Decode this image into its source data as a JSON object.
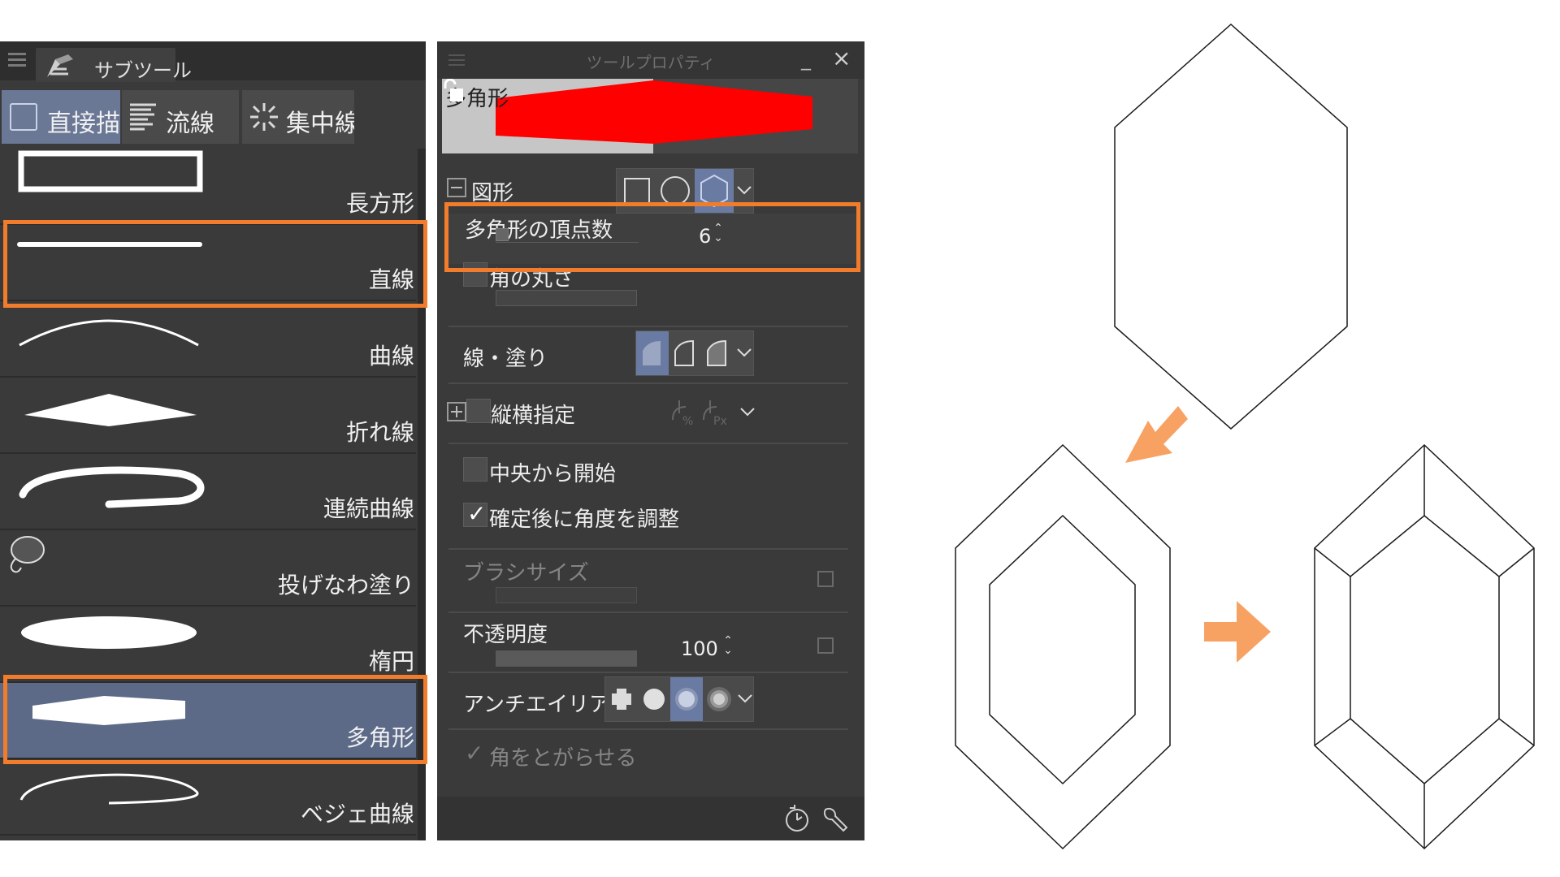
{
  "subtool_panel": {
    "tab_label": "サブツール",
    "group_tabs": [
      {
        "label": "直接描画",
        "active": true
      },
      {
        "label": "流線",
        "active": false
      },
      {
        "label": "集中線",
        "active": false
      }
    ],
    "items": [
      {
        "label": "長方形",
        "selected": false
      },
      {
        "label": "直線",
        "selected": false
      },
      {
        "label": "曲線",
        "selected": false
      },
      {
        "label": "折れ線",
        "selected": false
      },
      {
        "label": "連続曲線",
        "selected": false
      },
      {
        "label": "投げなわ塗り",
        "selected": false
      },
      {
        "label": "楕円",
        "selected": false
      },
      {
        "label": "多角形",
        "selected": true
      },
      {
        "label": "ベジェ曲線",
        "selected": false
      }
    ],
    "highlighted_items": [
      "直線",
      "多角形"
    ]
  },
  "tool_property": {
    "title": "ツールプロパティ",
    "minimize_label": "_",
    "close_label": "×",
    "preview_label": "多角形",
    "preview_color": "#ff0000",
    "shape_section": {
      "label": "図形",
      "options": [
        "square-icon",
        "circle-icon",
        "hexagon-icon"
      ],
      "selected": "hexagon-icon"
    },
    "vertex_count": {
      "label": "多角形の頂点数",
      "value": "6"
    },
    "rounded_corners": {
      "label": "角の丸さ",
      "checked": false
    },
    "line_fill": {
      "label": "線・塗り",
      "options": [
        "fill-icon",
        "line-icon",
        "line-fill-icon"
      ],
      "selected": "fill-icon"
    },
    "aspect": {
      "label": "縦横指定",
      "checked": false
    },
    "start_from_center": {
      "label": "中央から開始",
      "checked": false
    },
    "adjust_angle": {
      "label": "確定後に角度を調整",
      "checked": true
    },
    "brush_size": {
      "label": "ブラシサイズ",
      "disabled": true
    },
    "opacity": {
      "label": "不透明度",
      "value": "100"
    },
    "antialias": {
      "label": "アンチエイリアス",
      "options": [
        "none-icon",
        "weak-icon",
        "medium-icon",
        "strong-icon"
      ],
      "selected": "medium-icon"
    },
    "sharpen_corners": {
      "label": "角をとがらせる",
      "checked": true,
      "disabled": true
    },
    "footer_icons": [
      "reset-icon",
      "settings-wrench-icon"
    ]
  },
  "diagram": {
    "arrow_color": "#f7a263",
    "steps": [
      "hexagon-outline",
      "hexagon-with-inner",
      "gem-facets"
    ]
  }
}
